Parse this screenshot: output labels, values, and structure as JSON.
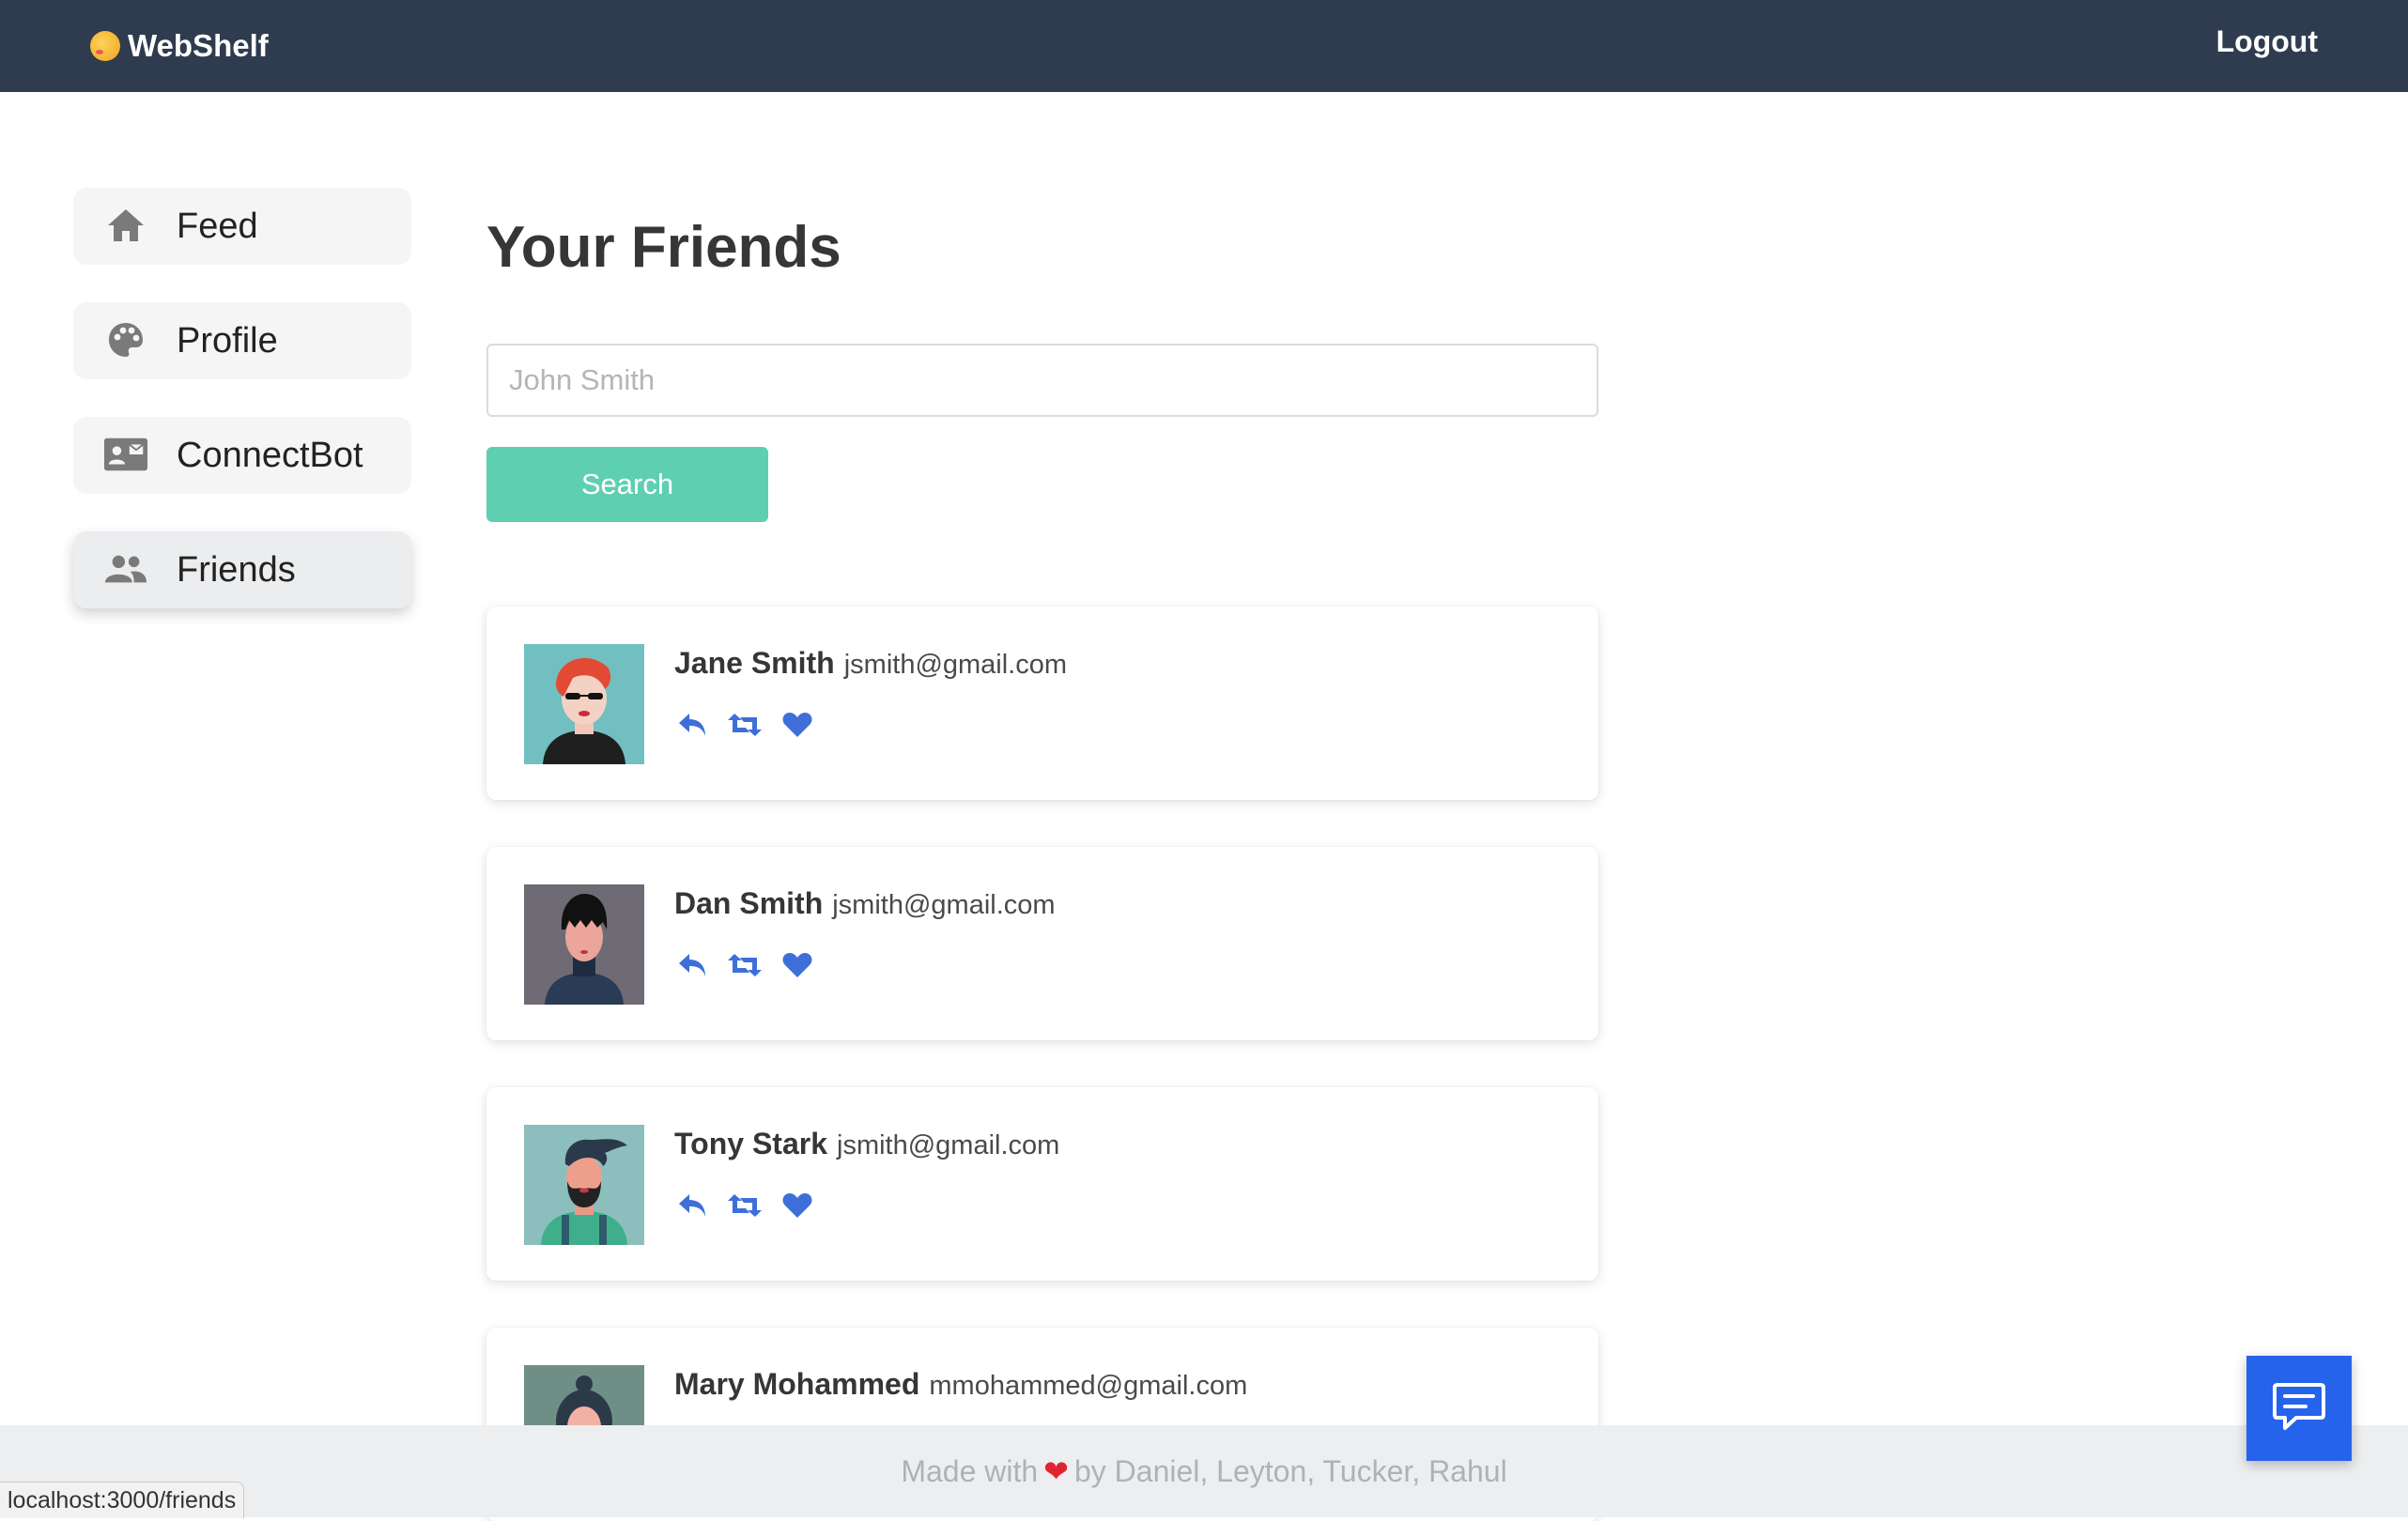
{
  "navbar": {
    "brand": "WebShelf",
    "logout_label": "Logout"
  },
  "sidebar": {
    "items": [
      {
        "label": "Feed",
        "icon": "home-icon"
      },
      {
        "label": "Profile",
        "icon": "palette-icon"
      },
      {
        "label": "ConnectBot",
        "icon": "id-card-icon"
      },
      {
        "label": "Friends",
        "icon": "users-icon",
        "active": true
      }
    ]
  },
  "main": {
    "title": "Your Friends",
    "search": {
      "placeholder": "John Smith",
      "button_label": "Search"
    },
    "friends": [
      {
        "name": "Jane Smith",
        "email": "jsmith@gmail.com"
      },
      {
        "name": "Dan Smith",
        "email": "jsmith@gmail.com"
      },
      {
        "name": "Tony Stark",
        "email": "jsmith@gmail.com"
      },
      {
        "name": "Mary Mohammed",
        "email": "mmohammed@gmail.com"
      }
    ]
  },
  "footer": {
    "prefix": "Made with",
    "suffix": "by Daniel, Leyton, Tucker, Rahul"
  },
  "status_bar": {
    "url": "localhost:3000/friends"
  },
  "colors": {
    "navbar": "#2f3b4e",
    "accent": "#5fcfb1",
    "action_icons": "#3e6fd9",
    "chat_button": "#2563eb"
  }
}
